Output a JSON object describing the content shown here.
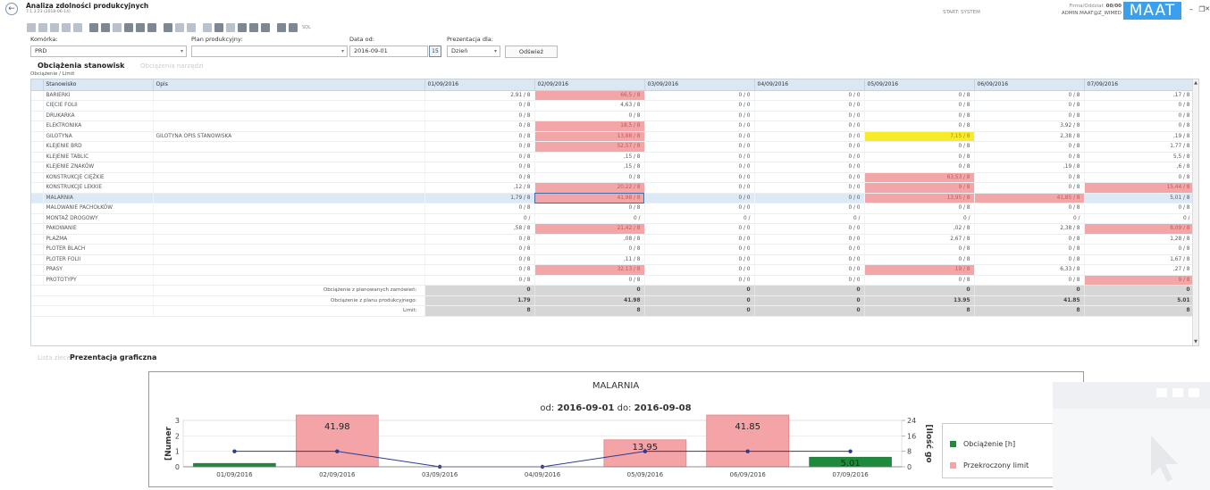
{
  "header": {
    "title": "Analiza zdolności produkcyjnych",
    "version": "7.1.3.23 (2018-06-14)",
    "start_label": "START: SYSTEM",
    "company_label": "Firma/Oddział:",
    "company_value": "00/00",
    "user": "ADMIN.MAAT@Z_WIMED",
    "logo": "MAAT"
  },
  "toolbar": {
    "sql_label": "SQL"
  },
  "filters": {
    "komorka_label": "Komórka:",
    "komorka_value": "PRD",
    "plan_label": "Plan produkcyjny:",
    "plan_value": "",
    "data_od_label": "Data od:",
    "data_od_value": "2016-09-01",
    "prezentacja_label": "Prezentacja dla:",
    "prezentacja_value": "Dzień",
    "refresh_label": "Odśwież"
  },
  "tabs": {
    "load": "Obciążenia stanowisk",
    "tools": "Obciążenia narzędzi",
    "subtitle": "Obciążenie / Limit",
    "list": "Lista zleceń",
    "graph": "Prezentacja graficzna"
  },
  "grid": {
    "columns": [
      "Stanowisko",
      "Opis",
      "01/09/2016",
      "02/09/2016",
      "03/09/2016",
      "04/09/2016",
      "05/09/2016",
      "06/09/2016",
      "07/09/2016"
    ],
    "rows": [
      {
        "name": "BARIERKI",
        "desc": "",
        "values": [
          "2,91 / 8",
          "66,5 / 8",
          "0 / 0",
          "0 / 0",
          "0 / 8",
          "0 / 8",
          ",17 / 8"
        ],
        "hl": [
          "",
          "red",
          "",
          "",
          "",
          "",
          ""
        ]
      },
      {
        "name": "CIĘCIE FOLII",
        "desc": "",
        "values": [
          "0 / 8",
          "4,63 / 8",
          "0 / 0",
          "0 / 0",
          "0 / 8",
          "0 / 8",
          "0 / 8"
        ],
        "hl": [
          "",
          "",
          "",
          "",
          "",
          "",
          ""
        ]
      },
      {
        "name": "DRUKARKA",
        "desc": "",
        "values": [
          "0 / 8",
          "0 / 8",
          "0 / 0",
          "0 / 0",
          "0 / 8",
          "0 / 8",
          "0 / 8"
        ],
        "hl": [
          "",
          "",
          "",
          "",
          "",
          "",
          ""
        ]
      },
      {
        "name": "ELEKTRONIKA",
        "desc": "",
        "values": [
          "0 / 8",
          "18,5 / 8",
          "0 / 0",
          "0 / 0",
          "0 / 8",
          "3,92 / 8",
          "0 / 8"
        ],
        "hl": [
          "",
          "red",
          "",
          "",
          "",
          "",
          ""
        ]
      },
      {
        "name": "GILOTYNA",
        "desc": "GILOTYNA OPIS STANOWISKA",
        "values": [
          "0 / 8",
          "13,88 / 8",
          "0 / 0",
          "0 / 0",
          "7,15 / 8",
          "2,38 / 8",
          ",19 / 8"
        ],
        "hl": [
          "",
          "red",
          "",
          "",
          "yel",
          "",
          ""
        ]
      },
      {
        "name": "KLEJENIE BRD",
        "desc": "",
        "values": [
          "0 / 8",
          "52,57 / 8",
          "0 / 0",
          "0 / 0",
          "0 / 8",
          "0 / 8",
          "1,77 / 8"
        ],
        "hl": [
          "",
          "red",
          "",
          "",
          "",
          "",
          ""
        ]
      },
      {
        "name": "KLEJENIE TABLIC",
        "desc": "",
        "values": [
          "0 / 8",
          ",15 / 8",
          "0 / 0",
          "0 / 0",
          "0 / 8",
          "0 / 8",
          "5,5 / 8"
        ],
        "hl": [
          "",
          "",
          "",
          "",
          "",
          "",
          ""
        ]
      },
      {
        "name": "KLEJENIE ZNAKÓW",
        "desc": "",
        "values": [
          "0 / 8",
          ",15 / 8",
          "0 / 0",
          "0 / 0",
          "0 / 8",
          ",19 / 8",
          ",6 / 8"
        ],
        "hl": [
          "",
          "",
          "",
          "",
          "",
          "",
          ""
        ]
      },
      {
        "name": "KONSTRUKCJE CIĘŻKIE",
        "desc": "",
        "values": [
          "0 / 8",
          "0 / 8",
          "0 / 0",
          "0 / 0",
          "63,53 / 8",
          "0 / 8",
          "0 / 8"
        ],
        "hl": [
          "",
          "",
          "",
          "",
          "red",
          "",
          ""
        ]
      },
      {
        "name": "KONSTRUKCJE LEKKIE",
        "desc": "",
        "values": [
          ",12 / 8",
          "20,22 / 8",
          "0 / 0",
          "0 / 0",
          "9 / 8",
          "0 / 8",
          "15,44 / 8"
        ],
        "hl": [
          "",
          "red",
          "",
          "",
          "red",
          "",
          "red"
        ]
      },
      {
        "name": "MALARNIA",
        "desc": "",
        "values": [
          "1,79 / 8",
          "41,98 / 8",
          "0 / 0",
          "0 / 0",
          "13,95 / 8",
          "41,85 / 8",
          "5,01 / 8"
        ],
        "hl": [
          "",
          "red",
          "",
          "",
          "red",
          "red",
          ""
        ],
        "selected": true
      },
      {
        "name": "MALOWANIE PACHOŁKÓW",
        "desc": "",
        "values": [
          "0 / 8",
          "0 / 8",
          "0 / 0",
          "0 / 0",
          "0 / 8",
          "0 / 8",
          "0 / 8"
        ],
        "hl": [
          "",
          "",
          "",
          "",
          "",
          "",
          ""
        ]
      },
      {
        "name": "MONTAŻ DROGOWY",
        "desc": "",
        "values": [
          "0 /",
          "0 /",
          "0 /",
          "0 /",
          "0 /",
          "0 /",
          "0 /"
        ],
        "hl": [
          "",
          "",
          "",
          "",
          "",
          "",
          ""
        ]
      },
      {
        "name": "PAKOWANIE",
        "desc": "",
        "values": [
          ",58 / 8",
          "21,42 / 8",
          "0 / 0",
          "0 / 0",
          ",02 / 8",
          "2,38 / 8",
          "8,09 / 8"
        ],
        "hl": [
          "",
          "red",
          "",
          "",
          "",
          "",
          "red"
        ]
      },
      {
        "name": "PLAZMA",
        "desc": "",
        "values": [
          "0 / 8",
          ",08 / 8",
          "0 / 0",
          "0 / 0",
          "2,67 / 8",
          "0 / 8",
          "1,28 / 8"
        ],
        "hl": [
          "",
          "",
          "",
          "",
          "",
          "",
          ""
        ]
      },
      {
        "name": "PLOTER BLACH",
        "desc": "",
        "values": [
          "0 / 8",
          "0 / 8",
          "0 / 0",
          "0 / 0",
          "0 / 8",
          "0 / 8",
          "0 / 8"
        ],
        "hl": [
          "",
          "",
          "",
          "",
          "",
          "",
          ""
        ]
      },
      {
        "name": "PLOTER FOLII",
        "desc": "",
        "values": [
          "0 / 8",
          ",11 / 8",
          "0 / 0",
          "0 / 0",
          "0 / 8",
          "0 / 8",
          "1,67 / 8"
        ],
        "hl": [
          "",
          "",
          "",
          "",
          "",
          "",
          ""
        ]
      },
      {
        "name": "PRASY",
        "desc": "",
        "values": [
          "0 / 8",
          "32,13 / 8",
          "0 / 0",
          "0 / 0",
          "19 / 8",
          "6,33 / 8",
          ",27 / 8"
        ],
        "hl": [
          "",
          "red",
          "",
          "",
          "red",
          "",
          ""
        ]
      },
      {
        "name": "PROTOTYPY",
        "desc": "",
        "values": [
          "0 / 8",
          "0 / 8",
          "0 / 0",
          "0 / 0",
          "0 / 8",
          "0 / 8",
          "9 / 8"
        ],
        "hl": [
          "",
          "",
          "",
          "",
          "",
          "",
          "red"
        ]
      }
    ],
    "summary": [
      {
        "label": "Obciążenie z planowanych zamówień:",
        "values": [
          "0",
          "0",
          "0",
          "0",
          "0",
          "0",
          "0"
        ]
      },
      {
        "label": "Obciążenie z planu produkcyjnego:",
        "values": [
          "1.79",
          "41.98",
          "0",
          "0",
          "13.95",
          "41.85",
          "5.01"
        ]
      },
      {
        "label": "Limit:",
        "values": [
          "8",
          "8",
          "0",
          "0",
          "8",
          "8",
          "8"
        ]
      }
    ]
  },
  "chart_data": {
    "type": "bar",
    "title": "MALARNIA",
    "subtitle_prefix": "od:",
    "subtitle_from": "2016-09-01",
    "subtitle_mid": "do:",
    "subtitle_to": "2016-09-08",
    "categories": [
      "01/09/2016",
      "02/09/2016",
      "03/09/2016",
      "04/09/2016",
      "05/09/2016",
      "06/09/2016",
      "07/09/2016"
    ],
    "series": [
      {
        "name": "Obciążenie [h]",
        "values": [
          1.79,
          41.98,
          0,
          0,
          13.95,
          41.85,
          5.01
        ],
        "color": "#1e8a3c"
      },
      {
        "name": "Przekroczony limit",
        "color": "#f4a3a6"
      }
    ],
    "bar_labels": [
      "",
      "41.98",
      "",
      "",
      "13.95",
      "41.85",
      "5.01"
    ],
    "over_limit": [
      false,
      true,
      false,
      false,
      true,
      true,
      false
    ],
    "limit_line": [
      8,
      8,
      0,
      0,
      8,
      8,
      8
    ],
    "limit_color": "#2c3a8c",
    "left_axis": {
      "label": "[Numer",
      "ticks": [
        "0",
        "1",
        "2",
        "3"
      ],
      "ylim": [
        0,
        3
      ]
    },
    "right_axis": {
      "label": "[Ilość go",
      "ticks": [
        "0",
        "8",
        "16",
        "24"
      ],
      "ylim": [
        0,
        24
      ]
    }
  },
  "colors": {
    "accent": "#3aa0ee",
    "header_bg": "#dbe7f3",
    "over_limit": "#f3a6a8",
    "warning": "#f8ec2a",
    "selected_row": "#dceaf8"
  }
}
